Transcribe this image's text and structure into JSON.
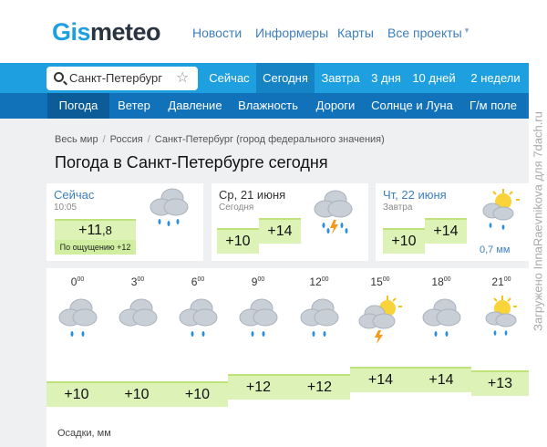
{
  "header": {
    "logo_part1": "Gis",
    "logo_part2": "meteo",
    "nav": [
      {
        "label": "Новости"
      },
      {
        "label": "Информеры"
      },
      {
        "label": "Карты"
      },
      {
        "label": "Все проекты"
      }
    ]
  },
  "tabs": {
    "search_value": "Санкт-Петербург",
    "items": [
      {
        "label": "Сейчас"
      },
      {
        "label": "Сегодня"
      },
      {
        "label": "Завтра"
      },
      {
        "label": "3 дня"
      },
      {
        "label": "10 дней"
      },
      {
        "label": "2 недели"
      }
    ],
    "active": "Сегодня"
  },
  "subnav": {
    "items": [
      {
        "label": "Погода"
      },
      {
        "label": "Ветер"
      },
      {
        "label": "Давление"
      },
      {
        "label": "Влажность"
      },
      {
        "label": "Дороги"
      },
      {
        "label": "Солнце и Луна"
      },
      {
        "label": "Г/м поле"
      }
    ],
    "active": "Погода"
  },
  "breadcrumb": [
    "Весь мир",
    "Россия",
    "Санкт-Петербург (город федерального значения)"
  ],
  "page_title": "Погода в Санкт-Петербурге сегодня",
  "now_card": {
    "title": "Сейчас",
    "time": "10:05",
    "temp_main": "+11",
    "temp_dec": ",8",
    "feels_like": "По ощущению +12",
    "icon": "cloudy-rain-icon"
  },
  "today_card": {
    "day": "Ср,",
    "date": "21 июня",
    "sub": "Сегодня",
    "temp_min": "+10",
    "temp_max": "+14",
    "icon": "thunderstorm-icon"
  },
  "tomorrow_card": {
    "day": "Чт,",
    "date": "22 июня",
    "sub": "Завтра",
    "temp_min": "+10",
    "temp_max": "+14",
    "precip": "0,7 мм",
    "icon": "sun-cloud-rain-icon"
  },
  "hourly": {
    "hours": [
      {
        "h": "0",
        "temp": "+10",
        "icon": "cloudy-rain-icon"
      },
      {
        "h": "3",
        "temp": "+10",
        "icon": "cloudy-icon"
      },
      {
        "h": "6",
        "temp": "+10",
        "icon": "cloudy-rain-icon"
      },
      {
        "h": "9",
        "temp": "+12",
        "icon": "cloudy-rain-icon"
      },
      {
        "h": "12",
        "temp": "+12",
        "icon": "cloudy-rain-icon"
      },
      {
        "h": "15",
        "temp": "+14",
        "icon": "sun-cloud-thunder-icon"
      },
      {
        "h": "18",
        "temp": "+14",
        "icon": "cloudy-rain-icon"
      },
      {
        "h": "21",
        "temp": "+13",
        "icon": "sun-cloud-rain-icon"
      }
    ],
    "minutes_sup": "00",
    "precip_label": "Осадки, мм"
  },
  "colors": {
    "brand_blue": "#1e9fe0",
    "subnav_blue": "#1172ba",
    "temp_green": "#dcf2b6",
    "link_blue": "#3d7fc1"
  },
  "watermark": "Загружено InnaRaevnikova для 7dach.ru"
}
